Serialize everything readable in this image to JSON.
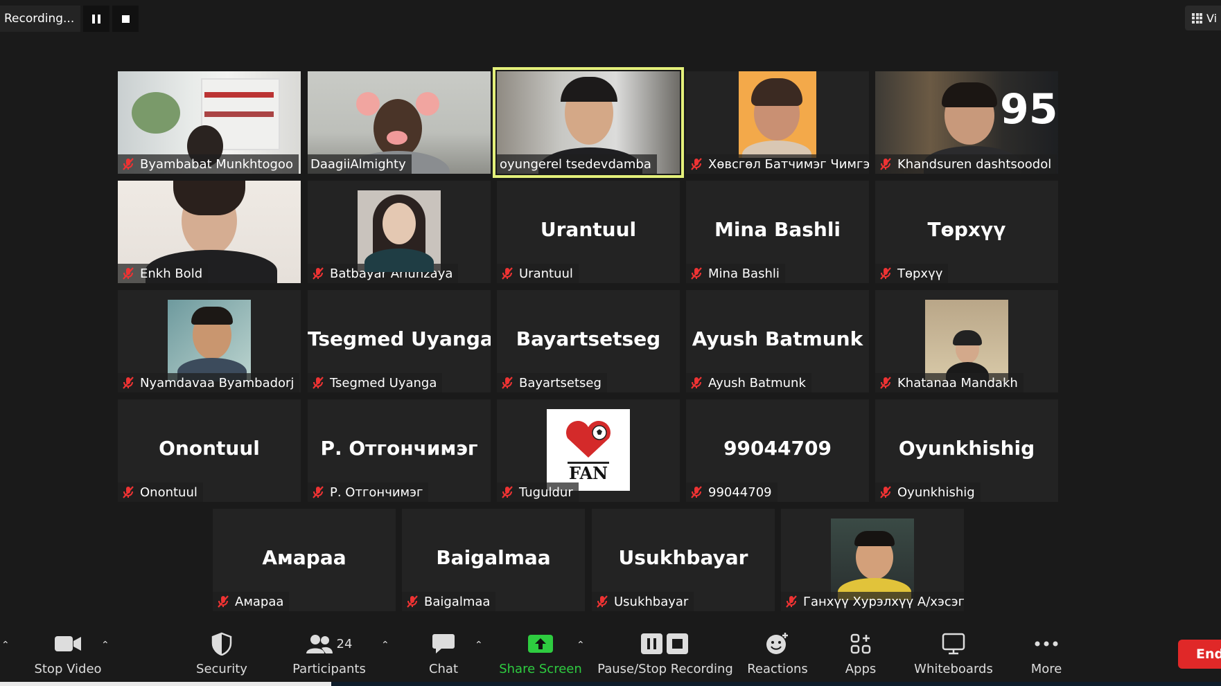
{
  "recording": {
    "status": "Recording...",
    "pause_icon": "pause-icon",
    "stop_icon": "stop-icon"
  },
  "view_button": {
    "label": "Vi",
    "icon": "grid-icon"
  },
  "participants": [
    {
      "name": "Byambabat Munkhtogoo",
      "video": true,
      "muted": true
    },
    {
      "name": "DaagiiAlmighty",
      "video": true,
      "muted": false
    },
    {
      "name": "oyungerel tsedevdamba",
      "video": true,
      "muted": false,
      "active_speaker": true
    },
    {
      "name": "Хөвсгөл Батчимэг Чимгээ",
      "video": true,
      "muted": true
    },
    {
      "name": "Khandsuren dashtsoodol",
      "video": true,
      "muted": true
    },
    {
      "name": "Enkh Bold",
      "video": true,
      "muted": true
    },
    {
      "name": "Batbayar Ariunzaya",
      "profile_picture": true,
      "muted": true
    },
    {
      "name": "Urantuul",
      "display_name": "Urantuul",
      "muted": true
    },
    {
      "name": "Mina Bashli",
      "display_name": "Mina Bashli",
      "muted": true
    },
    {
      "name": "Төрхүү",
      "display_name": "Төрхүү",
      "muted": true
    },
    {
      "name": "Nyamdavaa Byambadorj",
      "profile_picture": true,
      "muted": true
    },
    {
      "name": "Tsegmed Uyanga",
      "display_name": "Tsegmed Uyanga",
      "muted": true
    },
    {
      "name": "Bayartsetseg",
      "display_name": "Bayartsetseg",
      "muted": true
    },
    {
      "name": "Ayush Batmunk",
      "display_name": "Ayush Batmunk",
      "muted": true
    },
    {
      "name": "Khatanaa Mandakh",
      "profile_picture": true,
      "muted": true
    },
    {
      "name": "Onontuul",
      "display_name": "Onontuul",
      "muted": true
    },
    {
      "name": "Р. Отгончимэг",
      "display_name": "Р. Отгончимэг",
      "muted": true
    },
    {
      "name": "Tuguldur",
      "profile_picture": true,
      "logo_text": "FAN",
      "muted": true
    },
    {
      "name": "99044709",
      "display_name": "99044709",
      "muted": true
    },
    {
      "name": "Oyunkhishig",
      "display_name": "Oyunkhishig",
      "muted": true
    },
    {
      "name": "Амараа",
      "display_name": "Амараа",
      "muted": true
    },
    {
      "name": "Baigalmaa",
      "display_name": "Baigalmaa",
      "muted": true
    },
    {
      "name": "Usukhbayar",
      "display_name": "Usukhbayar",
      "muted": true
    },
    {
      "name": "Ганхүү Хурэлхүү А/хэсэг",
      "profile_picture": true,
      "muted": true
    }
  ],
  "toolbar": {
    "stop_video": {
      "label": "Stop Video",
      "icon": "video-camera-icon"
    },
    "security": {
      "label": "Security",
      "icon": "shield-icon"
    },
    "participants": {
      "label": "Participants",
      "icon": "participants-icon",
      "count": "24"
    },
    "chat": {
      "label": "Chat",
      "icon": "chat-bubble-icon"
    },
    "share_screen": {
      "label": "Share Screen",
      "icon": "share-screen-icon",
      "color": "#2ecc40"
    },
    "pause_stop_recording": {
      "label": "Pause/Stop Recording",
      "icon": "pause-stop-icon"
    },
    "reactions": {
      "label": "Reactions",
      "icon": "emoji-icon"
    },
    "apps": {
      "label": "Apps",
      "icon": "apps-icon"
    },
    "whiteboards": {
      "label": "Whiteboards",
      "icon": "whiteboard-icon"
    },
    "more": {
      "label": "More",
      "icon": "ellipsis-icon"
    },
    "end": {
      "label": "End",
      "color": "#e02828"
    }
  }
}
